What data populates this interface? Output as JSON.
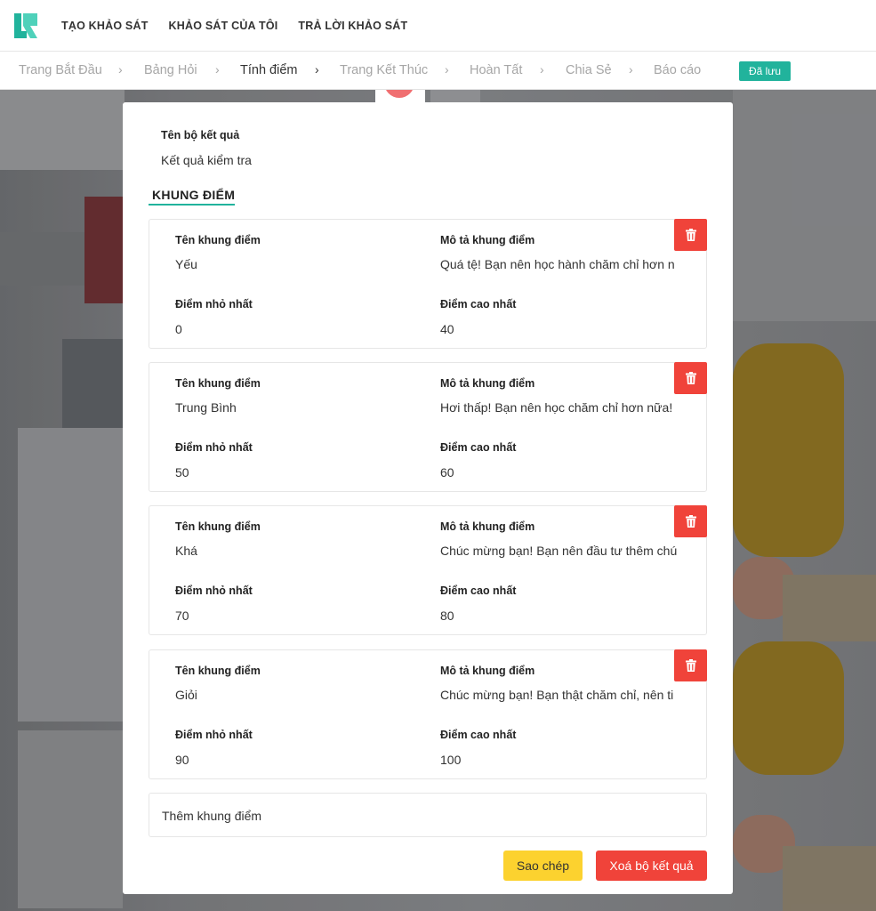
{
  "nav": {
    "links": [
      "TẠO KHẢO SÁT",
      "KHẢO SÁT CỦA TÔI",
      "TRẢ LỜI KHẢO SÁT"
    ]
  },
  "steps": {
    "items": [
      "Trang Bắt Đầu",
      "Bảng Hỏi",
      "Tính điểm",
      "Trang Kết Thúc",
      "Hoàn Tất",
      "Chia Sẻ",
      "Báo cáo"
    ],
    "active": "Tính điểm",
    "saved_label": "Đã lưu"
  },
  "colors": {
    "accent": "#21b39c",
    "danger": "#f0433a",
    "warning": "#fcd22f"
  },
  "modal": {
    "result_set_label": "Tên bộ kết quả",
    "result_set_value": "Kết quả kiểm tra",
    "section_title": "KHUNG ĐIỂM",
    "field_labels": {
      "name": "Tên khung điểm",
      "description": "Mô tả khung điểm",
      "min": "Điểm nhỏ nhất",
      "max": "Điểm cao nhất"
    },
    "ranges": [
      {
        "name": "Yếu",
        "description": "Quá tệ! Bạn nên học hành chăm chỉ hơn n",
        "min": "0",
        "max": "40"
      },
      {
        "name": "Trung Bình",
        "description": "Hơi thấp! Bạn nên học chăm chỉ hơn nữa!",
        "min": "50",
        "max": "60"
      },
      {
        "name": "Khá",
        "description": "Chúc mừng bạn! Bạn nên đầu tư thêm chú",
        "min": "70",
        "max": "80"
      },
      {
        "name": "Giỏi",
        "description": "Chúc mừng bạn! Bạn thật chăm chỉ, nên ti",
        "min": "90",
        "max": "100"
      }
    ],
    "add_range_label": "Thêm khung điểm",
    "copy_label": "Sao chép",
    "delete_label": "Xoá bộ kết quả",
    "delete_icon": "trash-icon"
  }
}
